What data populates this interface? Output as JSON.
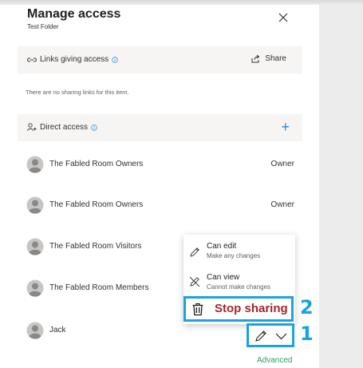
{
  "header": {
    "title": "Manage access",
    "subtitle": "Test Folder",
    "close_icon": "close-icon"
  },
  "links_section": {
    "label": "Links giving access",
    "share_label": "Share",
    "empty_text": "There are no sharing links for this item."
  },
  "direct_section": {
    "label": "Direct access",
    "add_label": "+"
  },
  "members": [
    {
      "name": "The Fabled Room Owners",
      "role": "Owner"
    },
    {
      "name": "The Fabled Room Owners",
      "role": "Owner"
    },
    {
      "name": "The Fabled Room Visitors",
      "role": ""
    },
    {
      "name": "The Fabled Room Members",
      "role": ""
    },
    {
      "name": "Jack",
      "role": ""
    }
  ],
  "menu": {
    "can_edit": {
      "title": "Can edit",
      "desc": "Make any changes"
    },
    "can_view": {
      "title": "Can view",
      "desc": "Cannot make changes"
    },
    "stop_sharing": "Stop sharing"
  },
  "annotations": {
    "one": "1",
    "two": "2"
  },
  "advanced_label": "Advanced",
  "colors": {
    "accent": "#1aa3dc",
    "danger": "#a4262c",
    "link": "#2f9e5a",
    "plus": "#2b88d8"
  }
}
